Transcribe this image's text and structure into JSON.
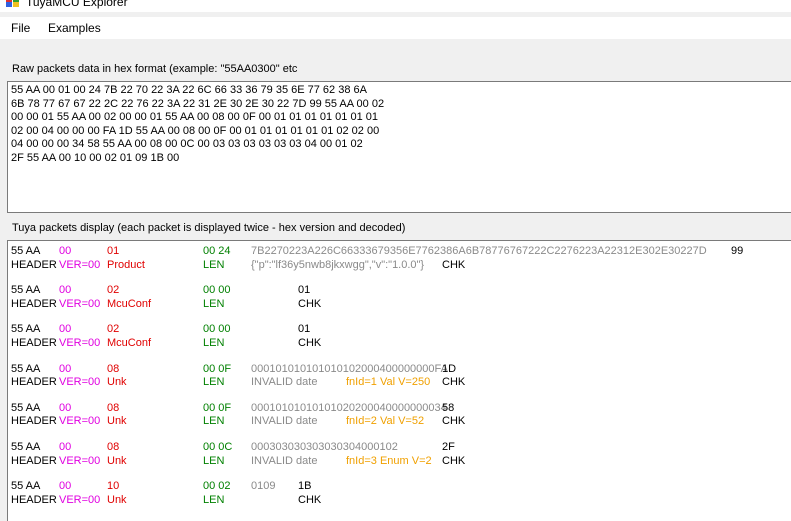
{
  "window": {
    "title": "TuyaMCU Explorer"
  },
  "menu": {
    "file": "File",
    "examples": "Examples"
  },
  "raw": {
    "label": "Raw packets data in hex format (example: \"55AA0300\" etc",
    "value": "55 AA 00 01 00 24 7B 22 70 22 3A 22 6C 66 33 36 79 35 6E 77 62 38 6A\n6B 78 77 67 67 22 2C 22 76 22 3A 22 31 2E 30 2E 30 22 7D 99 55 AA 00 02\n00 00 01 55 AA 00 02 00 00 01 55 AA 00 08 00 0F 00 01 01 01 01 01 01 01\n02 00 04 00 00 00 FA 1D 55 AA 00 08 00 0F 00 01 01 01 01 01 01 02 02 00\n04 00 00 00 34 58 55 AA 00 08 00 0C 00 03 03 03 03 03 03 04 00 01 02\n2F 55 AA 00 10 00 02 01 09 1B 00"
  },
  "tuya": {
    "label": "Tuya packets display (each packet is displayed twice - hex version and decoded)",
    "packets": [
      {
        "hex": {
          "header": "55 AA",
          "ver": "00",
          "cmd": "01",
          "len": "00 24",
          "data": "7B2270223A226C66333679356E7762386A6B78776767222C2276223A22312E302E30227D",
          "chk": "99"
        },
        "dec": {
          "header": "HEADER",
          "ver": "VER=00",
          "cmd": "Product",
          "len": "LEN",
          "data": "{\"p\":\"lf36y5nwb8jkxwgg\",\"v\":\"1.0.0\"}",
          "extra": "",
          "chk": "CHK"
        }
      },
      {
        "hex": {
          "header": "55 AA",
          "ver": "00",
          "cmd": "02",
          "len": "00 00",
          "data": "",
          "chk": "01"
        },
        "dec": {
          "header": "HEADER",
          "ver": "VER=00",
          "cmd": "McuConf",
          "len": "LEN",
          "data": "",
          "extra": "",
          "chk": "CHK"
        }
      },
      {
        "hex": {
          "header": "55 AA",
          "ver": "00",
          "cmd": "02",
          "len": "00 00",
          "data": "",
          "chk": "01"
        },
        "dec": {
          "header": "HEADER",
          "ver": "VER=00",
          "cmd": "McuConf",
          "len": "LEN",
          "data": "",
          "extra": "",
          "chk": "CHK"
        }
      },
      {
        "hex": {
          "header": "55 AA",
          "ver": "00",
          "cmd": "08",
          "len": "00 0F",
          "data": "000101010101010102000400000000FA",
          "chk": "1D"
        },
        "dec": {
          "header": "HEADER",
          "ver": "VER=00",
          "cmd": "Unk",
          "len": "LEN",
          "data": "INVALID date",
          "extra": "fnId=1 Val V=250",
          "chk": "CHK"
        }
      },
      {
        "hex": {
          "header": "55 AA",
          "ver": "00",
          "cmd": "08",
          "len": "00 0F",
          "data": "00010101010101020200040000000034",
          "chk": "58"
        },
        "dec": {
          "header": "HEADER",
          "ver": "VER=00",
          "cmd": "Unk",
          "len": "LEN",
          "data": "INVALID date",
          "extra": "fnId=2 Val V=52",
          "chk": "CHK"
        }
      },
      {
        "hex": {
          "header": "55 AA",
          "ver": "00",
          "cmd": "08",
          "len": "00 0C",
          "data": "000303030303030304000102",
          "chk": "2F"
        },
        "dec": {
          "header": "HEADER",
          "ver": "VER=00",
          "cmd": "Unk",
          "len": "LEN",
          "data": "INVALID date",
          "extra": "fnId=3 Enum V=2",
          "chk": "CHK"
        }
      },
      {
        "hex": {
          "header": "55 AA",
          "ver": "00",
          "cmd": "10",
          "len": "00 02",
          "data": "0109",
          "chk": "1B"
        },
        "dec": {
          "header": "HEADER",
          "ver": "VER=00",
          "cmd": "Unk",
          "len": "LEN",
          "data": "",
          "extra": "",
          "chk": "CHK"
        }
      }
    ]
  },
  "colors": {
    "ver": "#e000e0",
    "cmd": "#e00000",
    "len": "#008000",
    "data": "#8a8a8a",
    "fn": "#f0a000"
  }
}
